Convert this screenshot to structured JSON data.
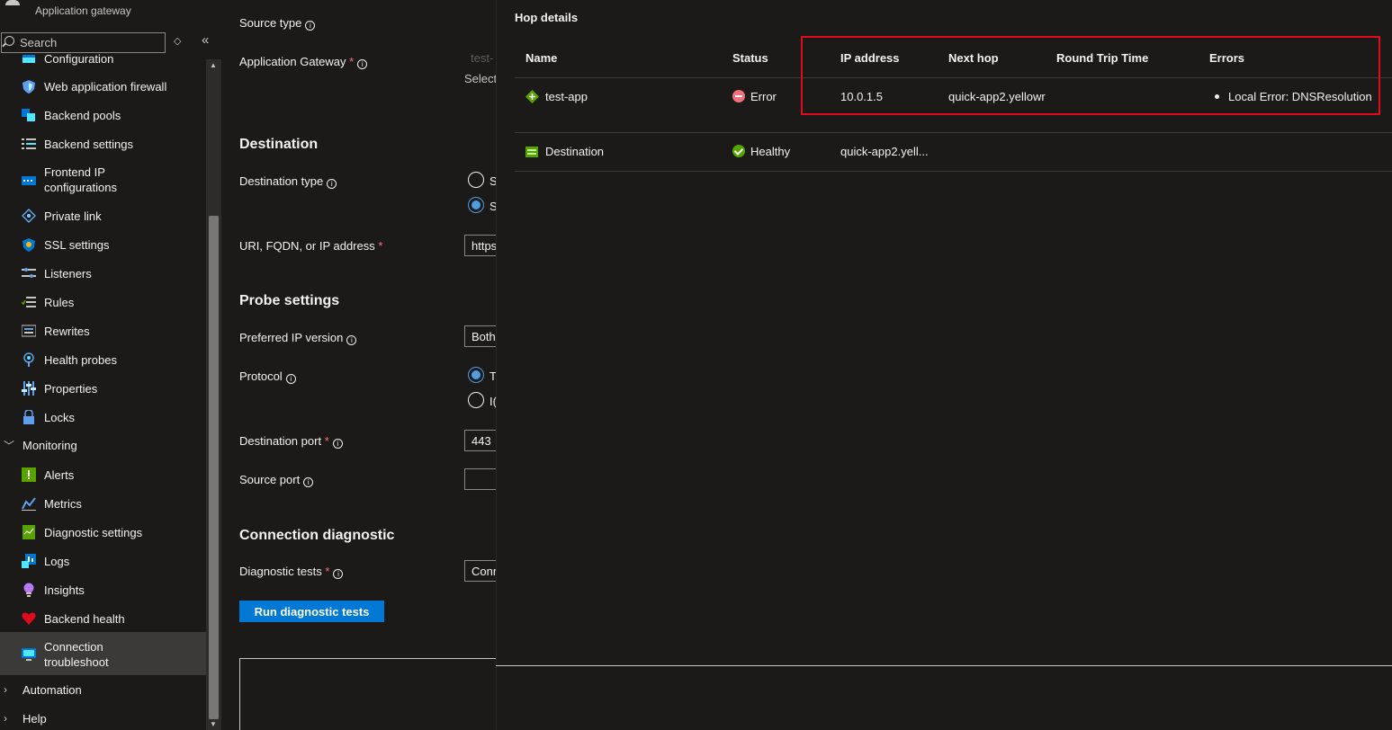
{
  "header": {
    "subtitle": "Application gateway"
  },
  "sidebar": {
    "search_placeholder": "Search",
    "items": [
      {
        "label": "Configuration",
        "icon": "configuration-icon"
      },
      {
        "label": "Web application firewall",
        "icon": "waf-shield-icon"
      },
      {
        "label": "Backend pools",
        "icon": "backend-pools-icon"
      },
      {
        "label": "Backend settings",
        "icon": "backend-settings-icon"
      },
      {
        "label": "Frontend IP",
        "label2": "configurations",
        "icon": "frontend-ip-icon"
      },
      {
        "label": "Private link",
        "icon": "private-link-icon"
      },
      {
        "label": "SSL settings",
        "icon": "ssl-shield-icon"
      },
      {
        "label": "Listeners",
        "icon": "listeners-icon"
      },
      {
        "label": "Rules",
        "icon": "rules-icon"
      },
      {
        "label": "Rewrites",
        "icon": "rewrites-icon"
      },
      {
        "label": "Health probes",
        "icon": "health-probes-icon"
      },
      {
        "label": "Properties",
        "icon": "properties-icon"
      },
      {
        "label": "Locks",
        "icon": "lock-icon"
      }
    ],
    "monitoring": {
      "label": "Monitoring",
      "items": [
        {
          "label": "Alerts",
          "icon": "alerts-icon"
        },
        {
          "label": "Metrics",
          "icon": "metrics-icon"
        },
        {
          "label": "Diagnostic settings",
          "icon": "diagnostic-settings-icon"
        },
        {
          "label": "Logs",
          "icon": "logs-icon"
        },
        {
          "label": "Insights",
          "icon": "insights-bulb-icon"
        },
        {
          "label": "Backend health",
          "icon": "heart-icon"
        },
        {
          "label": "Connection",
          "label2": "troubleshoot",
          "icon": "connection-troubleshoot-icon"
        }
      ]
    },
    "automation": "Automation",
    "help": "Help"
  },
  "form": {
    "source_type_label": "Source type",
    "app_gateway_label": "Application Gateway",
    "app_gateway_value": "test-",
    "select_link": "Select",
    "destination_title": "Destination",
    "destination_type_label": "Destination type",
    "dest_option_1": "S",
    "dest_option_2": "S",
    "uri_label": "URI, FQDN, or IP address",
    "uri_value": "https",
    "probe_title": "Probe settings",
    "ip_version_label": "Preferred IP version",
    "ip_version_value": "Both",
    "protocol_label": "Protocol",
    "protocol_option_1": "T",
    "protocol_option_2": "I(",
    "dest_port_label": "Destination port",
    "dest_port_value": "443",
    "source_port_label": "Source port",
    "source_port_value": "",
    "conn_diag_title": "Connection diagnostic",
    "diag_tests_label": "Diagnostic tests",
    "diag_tests_value": "Conn",
    "run_button": "Run diagnostic tests"
  },
  "panel": {
    "title": "Hop details",
    "columns": [
      "Name",
      "Status",
      "IP address",
      "Next hop",
      "Round Trip Time",
      "Errors"
    ],
    "rows": [
      {
        "name": "test-app",
        "name_icon": "app-gateway-icon",
        "status": "Error",
        "status_icon": "error-icon",
        "ip": "10.0.1.5",
        "next_hop": "quick-app2.yellowr",
        "rtt": "",
        "error": "Local Error: DNSResolution"
      },
      {
        "name": "Destination",
        "name_icon": "destination-icon",
        "status": "Healthy",
        "status_icon": "healthy-check-icon",
        "ip": "quick-app2.yell...",
        "next_hop": "",
        "rtt": "",
        "error": ""
      }
    ],
    "highlight_color": "#e00b1c"
  },
  "colors": {
    "background": "#1b1a19",
    "accent": "#0078d4",
    "error": "#f1707b",
    "healthy": "#57a300"
  }
}
